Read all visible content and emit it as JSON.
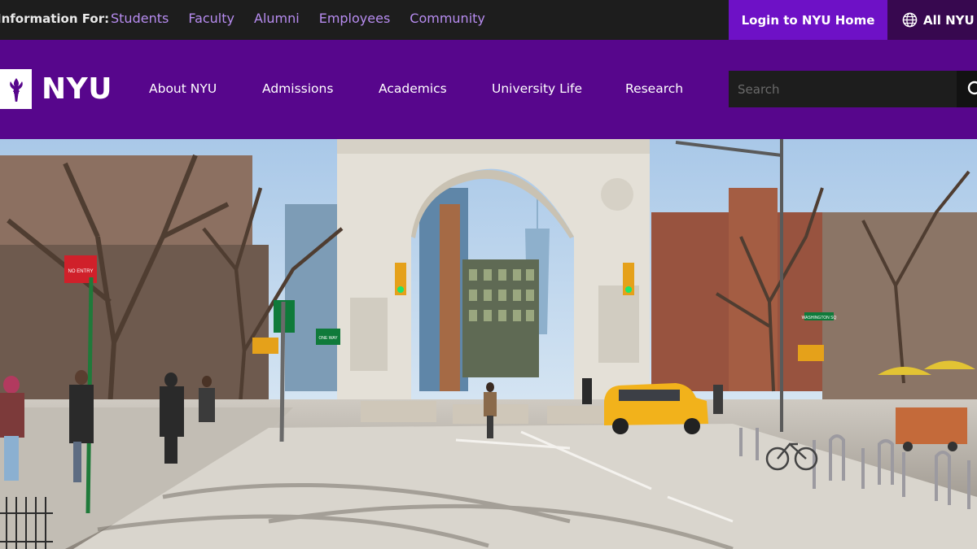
{
  "topbar": {
    "info_label": "Information For:",
    "audience_links": [
      "Students",
      "Faculty",
      "Alumni",
      "Employees",
      "Community"
    ],
    "login_label": "Login to NYU Home",
    "all_nyu_label": "All NYU"
  },
  "header": {
    "logo_text": "NYU",
    "nav": [
      "About NYU",
      "Admissions",
      "Academics",
      "University Life",
      "Research"
    ],
    "search_placeholder": "Search"
  },
  "hero": {
    "street_signs": [
      "NO ENTRY",
      "ONE WAY",
      "WASHINGTON SQ"
    ],
    "colors": {
      "sky": "#b9d4ee",
      "arch": "#e4e0d7",
      "taxi": "#f2b21b",
      "umbrella": "#e2c334",
      "street_sign_green": "#0f7a3a",
      "no_entry_red": "#d0202a"
    }
  },
  "colors": {
    "nyu_purple": "#57068c",
    "login_purple": "#6e11c6",
    "topbar_bg": "#1d1d1d",
    "audience_link": "#b78cf0"
  }
}
